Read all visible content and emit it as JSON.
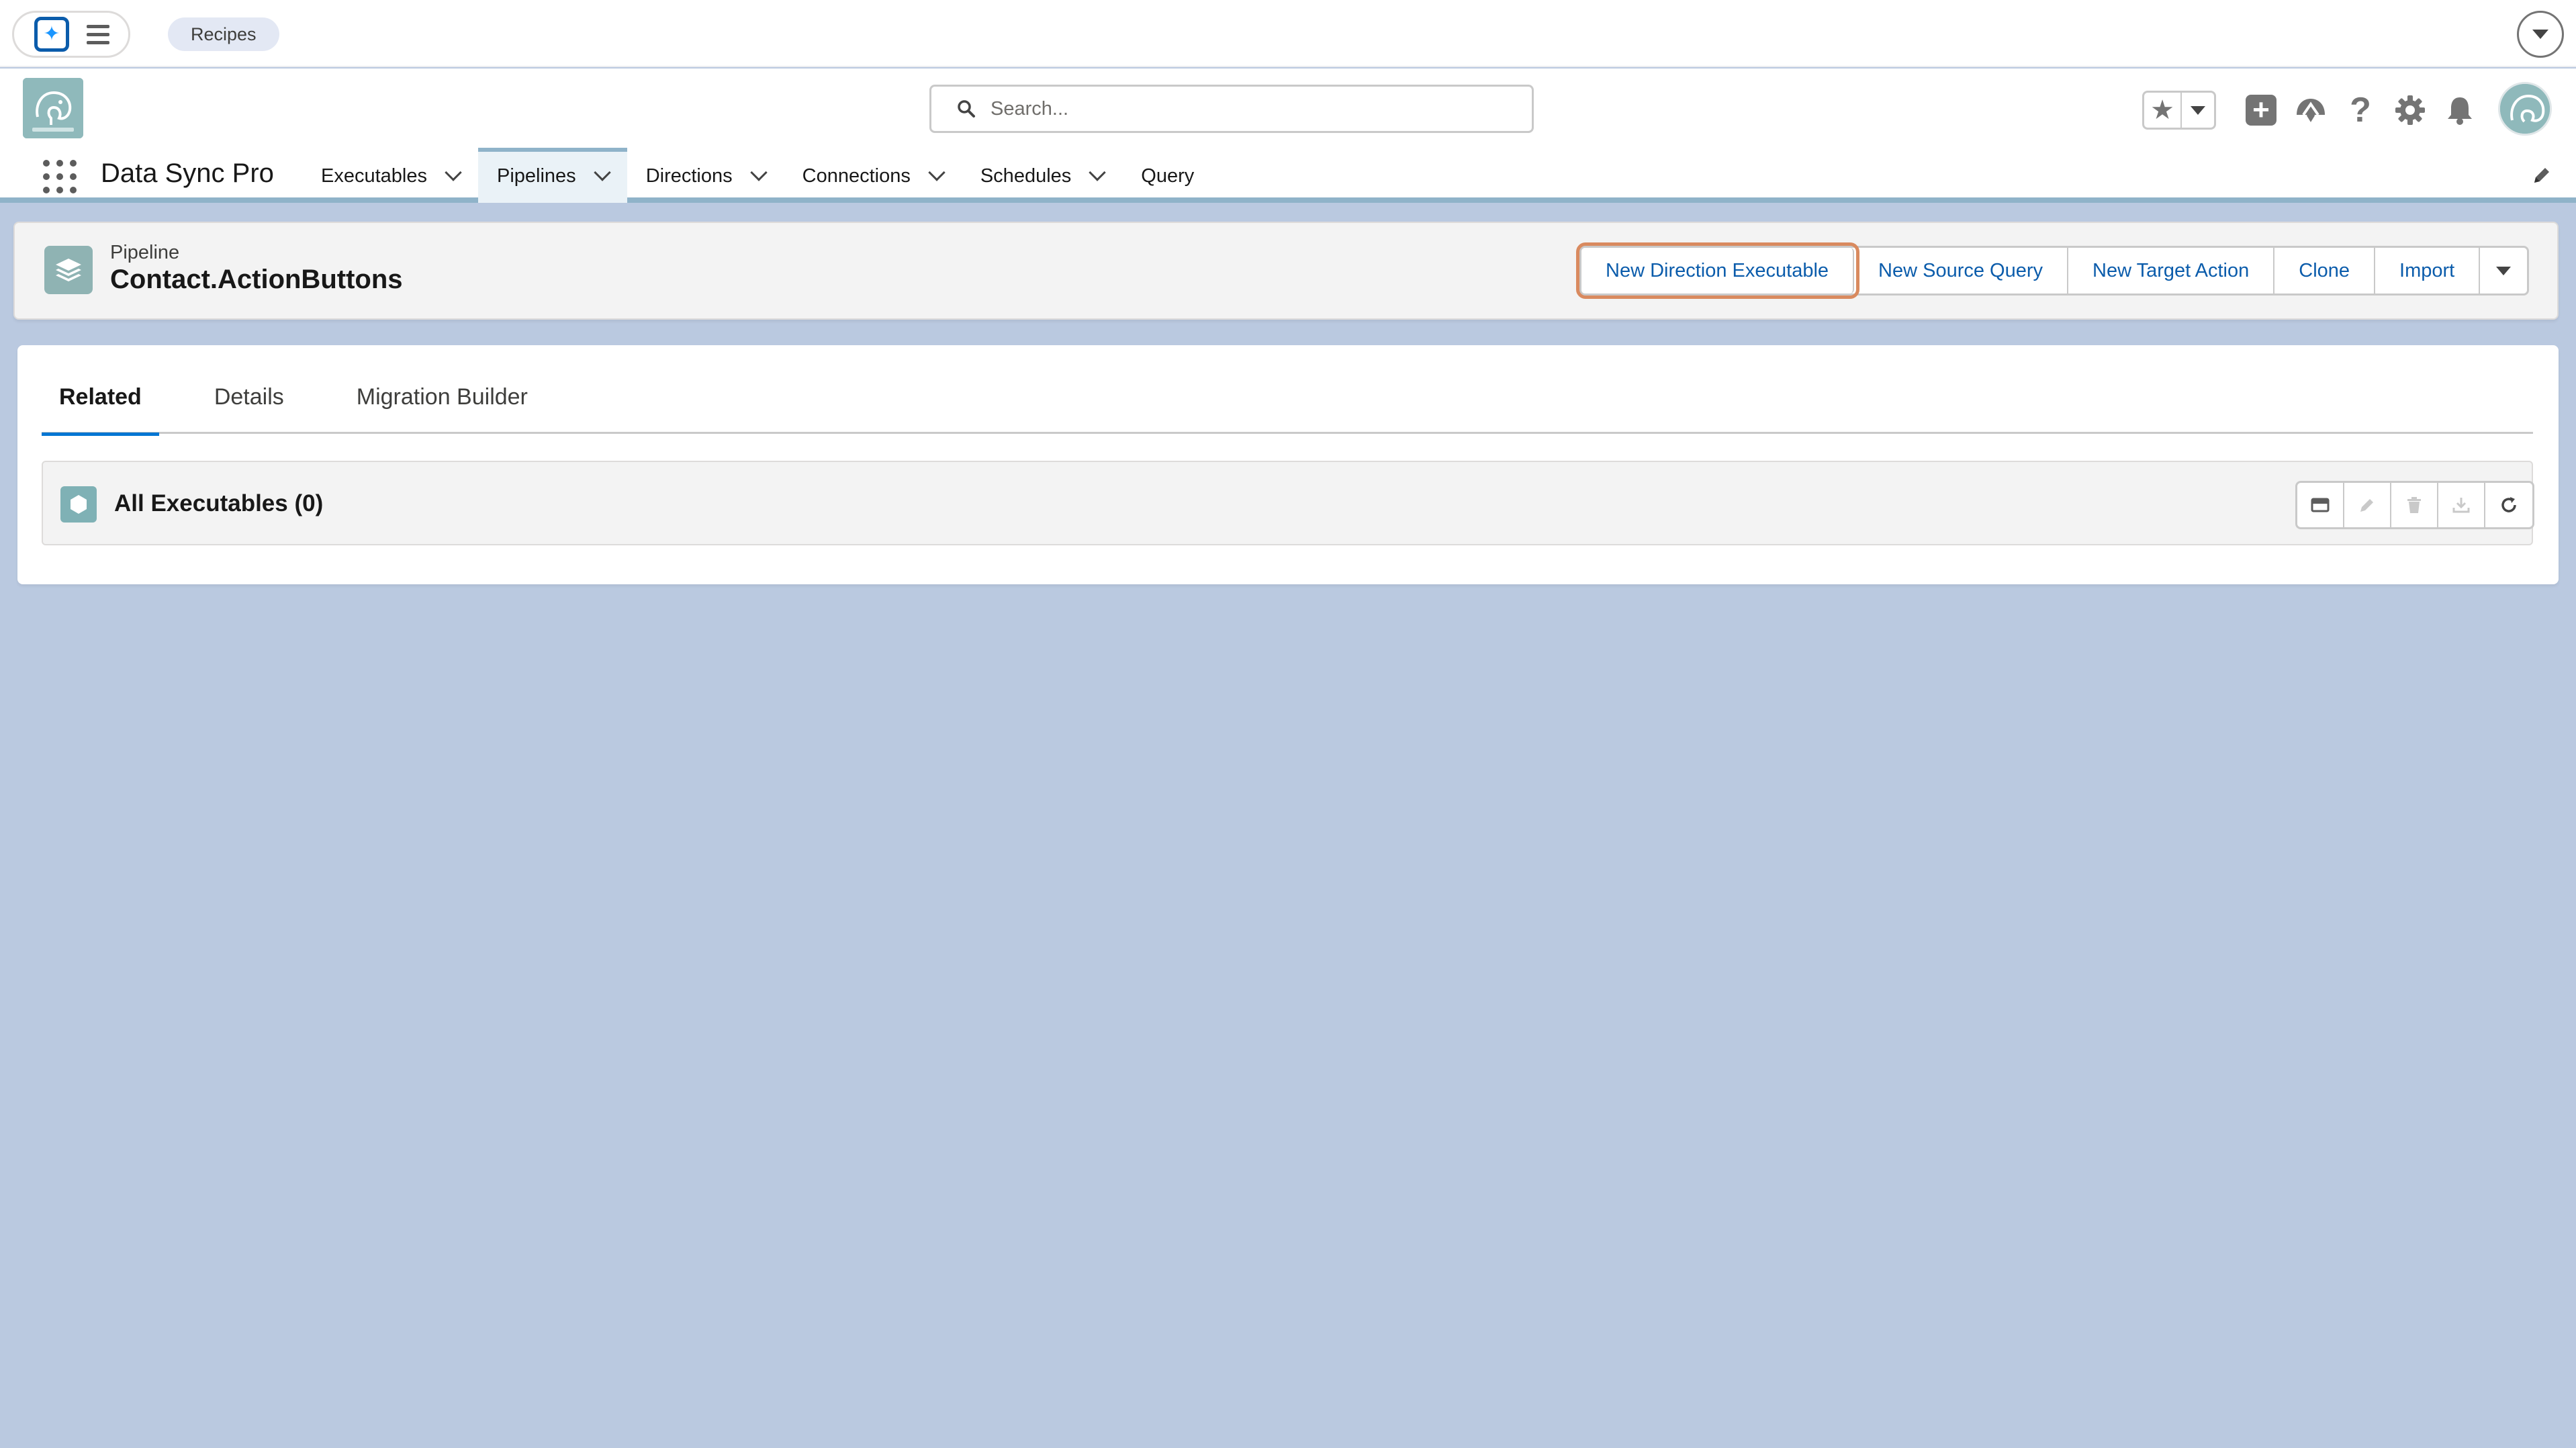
{
  "utility_bar": {
    "recipes_label": "Recipes"
  },
  "header": {
    "search_placeholder": "Search...",
    "icons": [
      "favorites-star-icon",
      "add-icon",
      "trailhead-icon",
      "help-icon",
      "setup-gear-icon",
      "notification-bell-icon"
    ]
  },
  "nav": {
    "app_name": "Data Sync Pro",
    "items": [
      {
        "label": "Executables",
        "has_menu": true,
        "active": false
      },
      {
        "label": "Pipelines",
        "has_menu": true,
        "active": true
      },
      {
        "label": "Directions",
        "has_menu": true,
        "active": false
      },
      {
        "label": "Connections",
        "has_menu": true,
        "active": false
      },
      {
        "label": "Schedules",
        "has_menu": true,
        "active": false
      },
      {
        "label": "Query",
        "has_menu": false,
        "active": false
      }
    ]
  },
  "record": {
    "object_type": "Pipeline",
    "title": "Contact.ActionButtons",
    "actions": {
      "new_direction_executable": "New Direction Executable",
      "new_source_query": "New Source Query",
      "new_target_action": "New Target Action",
      "clone": "Clone",
      "import": "Import"
    }
  },
  "tabs": {
    "related": "Related",
    "details": "Details",
    "migration_builder": "Migration Builder",
    "active": "Related"
  },
  "related_list": {
    "title": "All Executables (0)"
  },
  "colors": {
    "background": "#bac9e0",
    "brand_link": "#0b5cab",
    "tab_active_underline": "#0176d3",
    "highlight_outline": "#d98a5f",
    "record_icon": "#8fb3b3"
  }
}
